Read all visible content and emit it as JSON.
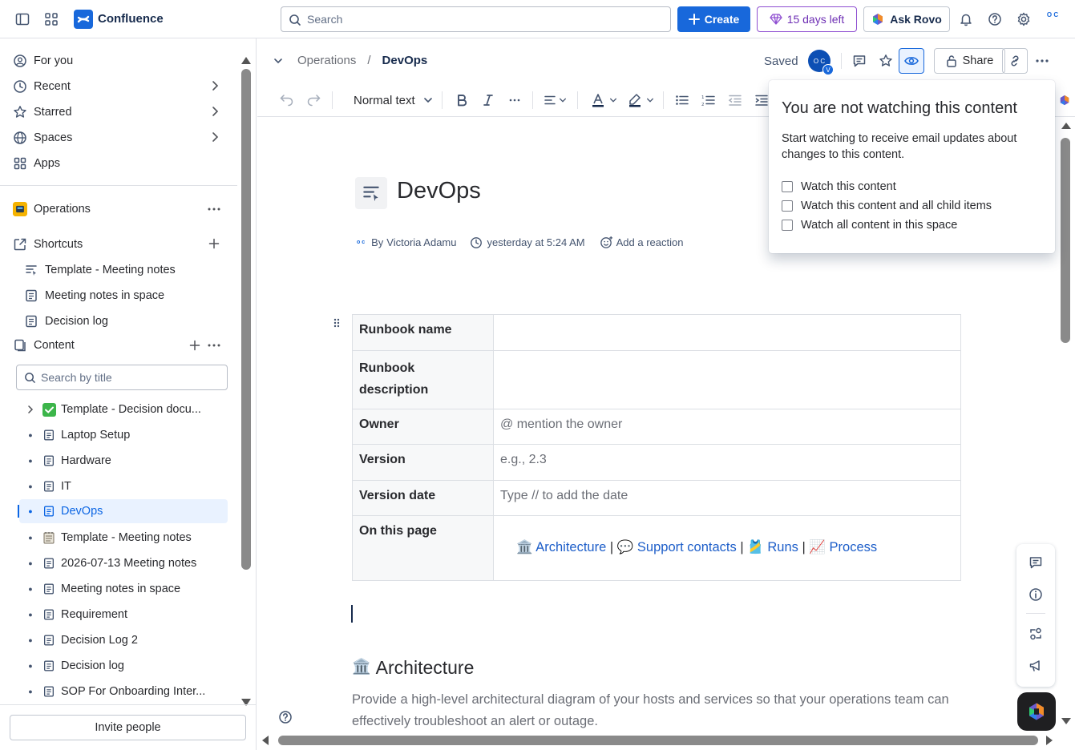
{
  "topbar": {
    "app_name": "Confluence",
    "search_placeholder": "Search",
    "create_label": "Create",
    "trial_label": "15 days left",
    "rovo_label": "Ask Rovo",
    "avatar_text": "O C"
  },
  "sidebar": {
    "nav": [
      {
        "label": "For you"
      },
      {
        "label": "Recent"
      },
      {
        "label": "Starred"
      },
      {
        "label": "Spaces"
      },
      {
        "label": "Apps"
      }
    ],
    "space_name": "Operations",
    "shortcuts_label": "Shortcuts",
    "shortcuts": [
      {
        "label": "Template - Meeting notes"
      },
      {
        "label": "Meeting notes in space"
      },
      {
        "label": "Decision log"
      }
    ],
    "content_label": "Content",
    "search_placeholder": "Search by title",
    "tree": [
      {
        "label": "Template - Decision docu..."
      },
      {
        "label": "Laptop Setup"
      },
      {
        "label": "Hardware"
      },
      {
        "label": "IT"
      },
      {
        "label": "DevOps"
      },
      {
        "label": "Template - Meeting notes"
      },
      {
        "label": "2026-07-13 Meeting notes"
      },
      {
        "label": "Meeting notes in space"
      },
      {
        "label": "Requirement"
      },
      {
        "label": "Decision Log 2"
      },
      {
        "label": "Decision log"
      },
      {
        "label": "SOP For Onboarding Inter..."
      }
    ],
    "invite_label": "Invite people"
  },
  "header": {
    "breadcrumb_parent": "Operations",
    "breadcrumb_current": "DevOps",
    "saved_label": "Saved",
    "avatar_text": "O C",
    "avatar_badge": "V",
    "share_label": "Share"
  },
  "toolbar": {
    "text_style": "Normal text"
  },
  "page": {
    "title": "DevOps",
    "author_prefix": "By",
    "author": "Victoria Adamu",
    "timestamp": "yesterday at 5:24 AM",
    "reaction_label": "Add a reaction",
    "table": {
      "rows": [
        {
          "label": "Runbook name",
          "value": ""
        },
        {
          "label": "Runbook description",
          "value": ""
        },
        {
          "label": "Owner",
          "value": "@ mention the owner"
        },
        {
          "label": "Version",
          "value": "e.g., 2.3"
        },
        {
          "label": "Version date",
          "value": "Type // to add the date"
        },
        {
          "label": "On this page",
          "value": ""
        }
      ],
      "links": [
        {
          "emoji": "🏛️",
          "label": "Architecture"
        },
        {
          "emoji": "💬",
          "label": "Support contacts"
        },
        {
          "emoji": "🎽",
          "label": "Runs"
        },
        {
          "emoji": "📈",
          "label": "Process"
        }
      ],
      "separator": "|"
    },
    "section_emoji": "🏛️",
    "section_title": "Architecture",
    "section_text": "Provide a high-level architectural diagram of your hosts and services so that your operations team can effectively troubleshoot an alert or outage."
  },
  "watch_popup": {
    "title": "You are not watching this content",
    "description": "Start watching to receive email updates about changes to this content.",
    "options": [
      {
        "label": "Watch this content",
        "checked": false
      },
      {
        "label": "Watch this content and all child items",
        "checked": false
      },
      {
        "label": "Watch all content in this space",
        "checked": false
      }
    ]
  },
  "colors": {
    "brand": "#1868db",
    "selected_bg": "#e9f2ff",
    "link": "#1d5ec9",
    "trial": "#8f4fd1"
  }
}
